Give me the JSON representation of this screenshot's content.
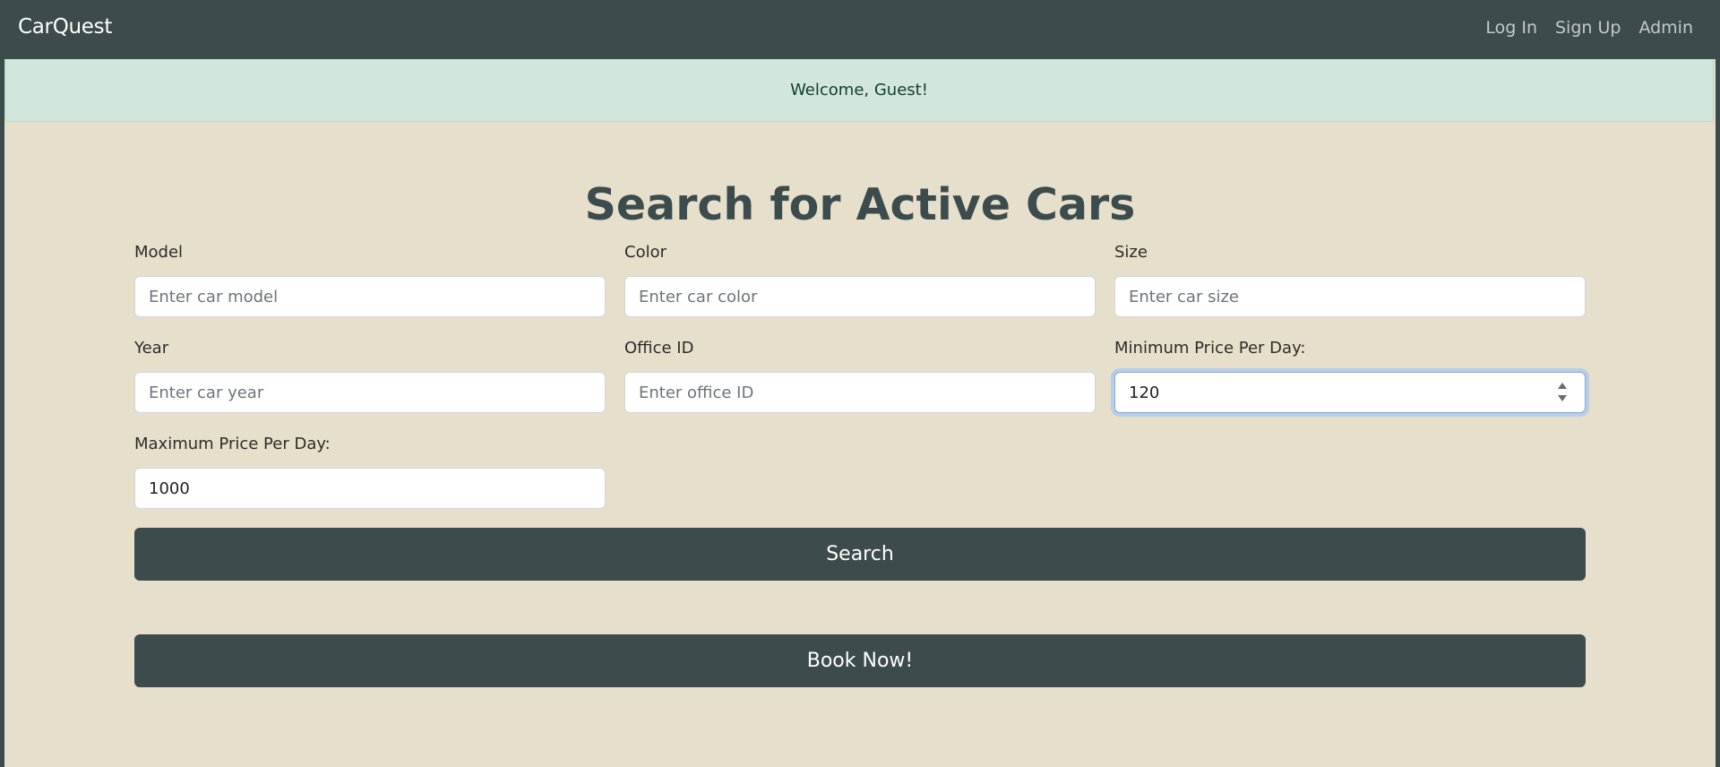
{
  "navbar": {
    "brand": "CarQuest",
    "links": [
      "Log In",
      "Sign Up",
      "Admin"
    ]
  },
  "alert": {
    "message": "Welcome, Guest!"
  },
  "search": {
    "title": "Search for Active Cars",
    "fields": {
      "model": {
        "label": "Model",
        "placeholder": "Enter car model",
        "value": ""
      },
      "color": {
        "label": "Color",
        "placeholder": "Enter car color",
        "value": ""
      },
      "size": {
        "label": "Size",
        "placeholder": "Enter car size",
        "value": ""
      },
      "year": {
        "label": "Year",
        "placeholder": "Enter car year",
        "value": ""
      },
      "office_id": {
        "label": "Office ID",
        "placeholder": "Enter office ID",
        "value": ""
      },
      "min_price": {
        "label": "Minimum Price Per Day:",
        "value": "120"
      },
      "max_price": {
        "label": "Maximum Price Per Day:",
        "value": "1000"
      }
    },
    "search_button": "Search",
    "book_button": "Book Now!"
  },
  "colors": {
    "navbar_bg": "#3c4b4c",
    "page_bg": "#e6dfcb",
    "alert_bg": "#d2e6dc",
    "button_bg": "#3c4b4c"
  }
}
